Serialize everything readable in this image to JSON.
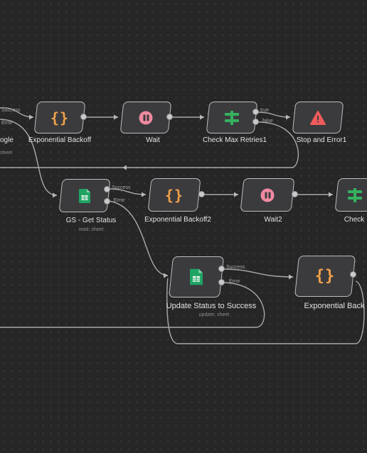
{
  "nodes": {
    "exp_backoff": {
      "label": "Exponential Backoff",
      "icon": "braces-icon"
    },
    "wait": {
      "label": "Wait",
      "icon": "pause-icon"
    },
    "check_max": {
      "label": "Check Max Retries1",
      "icon": "if-filter-icon"
    },
    "stop_error": {
      "label": "Stop and Error1",
      "icon": "warning-triangle-icon"
    },
    "google": {
      "label": "ogle",
      "sub": "sheet"
    },
    "gs_get_status": {
      "label": "GS - Get Status",
      "sub": "read: sheet",
      "icon": "google-sheets-icon"
    },
    "exp_backoff2": {
      "label": "Exponential Backoff2",
      "icon": "braces-icon"
    },
    "wait2": {
      "label": "Wait2",
      "icon": "pause-icon"
    },
    "check_partial": {
      "label": "Check",
      "icon": "if-filter-icon"
    },
    "update_status": {
      "label": "Update Status to Success",
      "sub": "update: sheet",
      "icon": "google-sheets-icon"
    },
    "exp_backoff_partial": {
      "label": "Exponential Back",
      "icon": "braces-icon"
    }
  },
  "port_labels": {
    "success": "Success",
    "error": "Error",
    "true": "true",
    "false": "false"
  },
  "colors": {
    "background": "#262627",
    "node_fill": "#3b3b3e",
    "node_border": "#bdbdbf",
    "edge": "#b8b8ba",
    "braces": "#f2a24a",
    "wait": "#ef8aa0",
    "if_node": "#35b15f",
    "stop": "#f05b5b",
    "sheets": "#1fa463"
  }
}
